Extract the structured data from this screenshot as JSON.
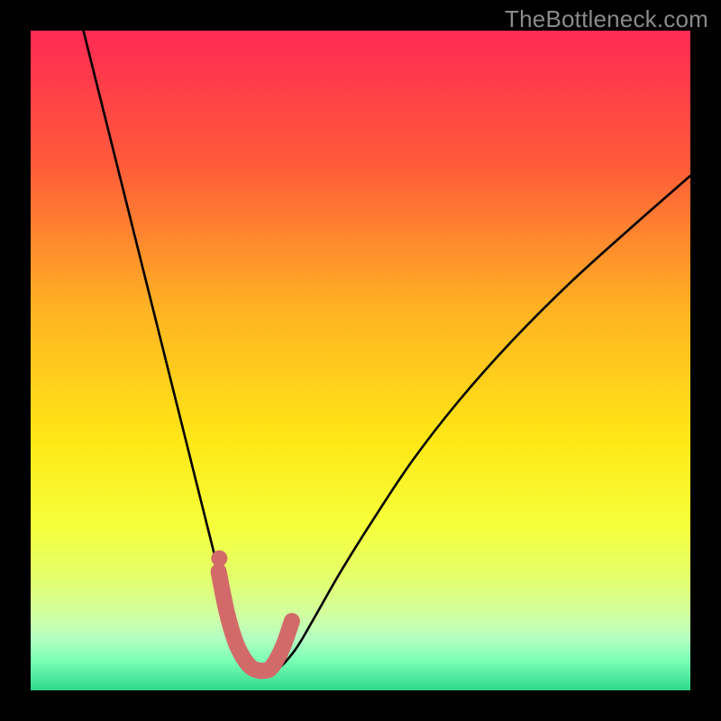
{
  "watermark": "TheBottleneck.com",
  "chart_data": {
    "type": "line",
    "title": "",
    "xlabel": "",
    "ylabel": "",
    "xlim": [
      0,
      100
    ],
    "ylim": [
      0,
      100
    ],
    "background_gradient_stops": [
      {
        "offset": 0.0,
        "color": "#ff2a54"
      },
      {
        "offset": 0.2,
        "color": "#ff5a3a"
      },
      {
        "offset": 0.42,
        "color": "#ffb223"
      },
      {
        "offset": 0.62,
        "color": "#ffe716"
      },
      {
        "offset": 0.75,
        "color": "#f6ff3a"
      },
      {
        "offset": 0.83,
        "color": "#e3ff6e"
      },
      {
        "offset": 0.885,
        "color": "#d2ffa0"
      },
      {
        "offset": 0.92,
        "color": "#b6ffc2"
      },
      {
        "offset": 0.955,
        "color": "#7affb6"
      },
      {
        "offset": 1.0,
        "color": "#2fd88b"
      }
    ],
    "series": [
      {
        "name": "bottleneck-curve",
        "x": [
          8,
          10,
          12,
          14,
          16,
          18,
          20,
          22,
          24,
          26,
          28,
          29.5,
          31,
          32.5,
          34,
          35.5,
          37,
          40,
          43,
          47,
          52,
          58,
          65,
          73,
          82,
          92,
          100
        ],
        "y": [
          100,
          92,
          84,
          76,
          68,
          60,
          52,
          44,
          36,
          28,
          20,
          14,
          9,
          5.5,
          3.2,
          2.4,
          2.8,
          6,
          11,
          18,
          26,
          35,
          44,
          53,
          62,
          71,
          78
        ]
      }
    ],
    "highlight_segment": {
      "name": "optimal-range",
      "color": "#d26a6a",
      "x": [
        28.5,
        29.7,
        31.0,
        32.2,
        33.4,
        34.6,
        35.4,
        36.2,
        37.2,
        38.4,
        39.6
      ],
      "y": [
        18.0,
        12.0,
        7.5,
        5.0,
        3.5,
        3.0,
        3.0,
        3.2,
        4.5,
        7.0,
        10.5
      ]
    },
    "highlight_dot": {
      "x": 28.6,
      "y": 20.0,
      "color": "#d26a6a"
    }
  }
}
